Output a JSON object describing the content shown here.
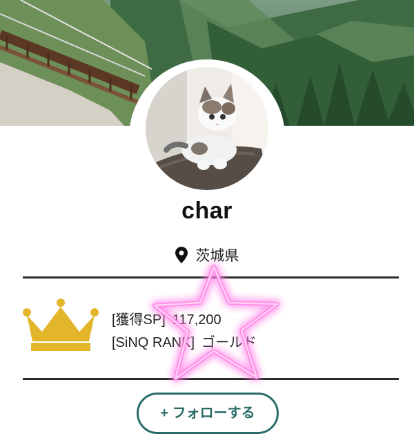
{
  "profile": {
    "username": "char",
    "location": "茨城県"
  },
  "stats": {
    "sp_label": "[獲得SP]",
    "sp_value": "117,200",
    "rank_label": "[SiNQ RANK]",
    "rank_value": "ゴールド"
  },
  "actions": {
    "follow_label": "+ フォローする"
  },
  "icons": {
    "location": "location-pin-icon",
    "rank": "crown-icon",
    "overlay": "star-icon"
  },
  "colors": {
    "accent": "#2a6b68",
    "crown": "#e3b52b",
    "star_glow": "#ff7ee6",
    "divider": "#2b2b2b"
  }
}
